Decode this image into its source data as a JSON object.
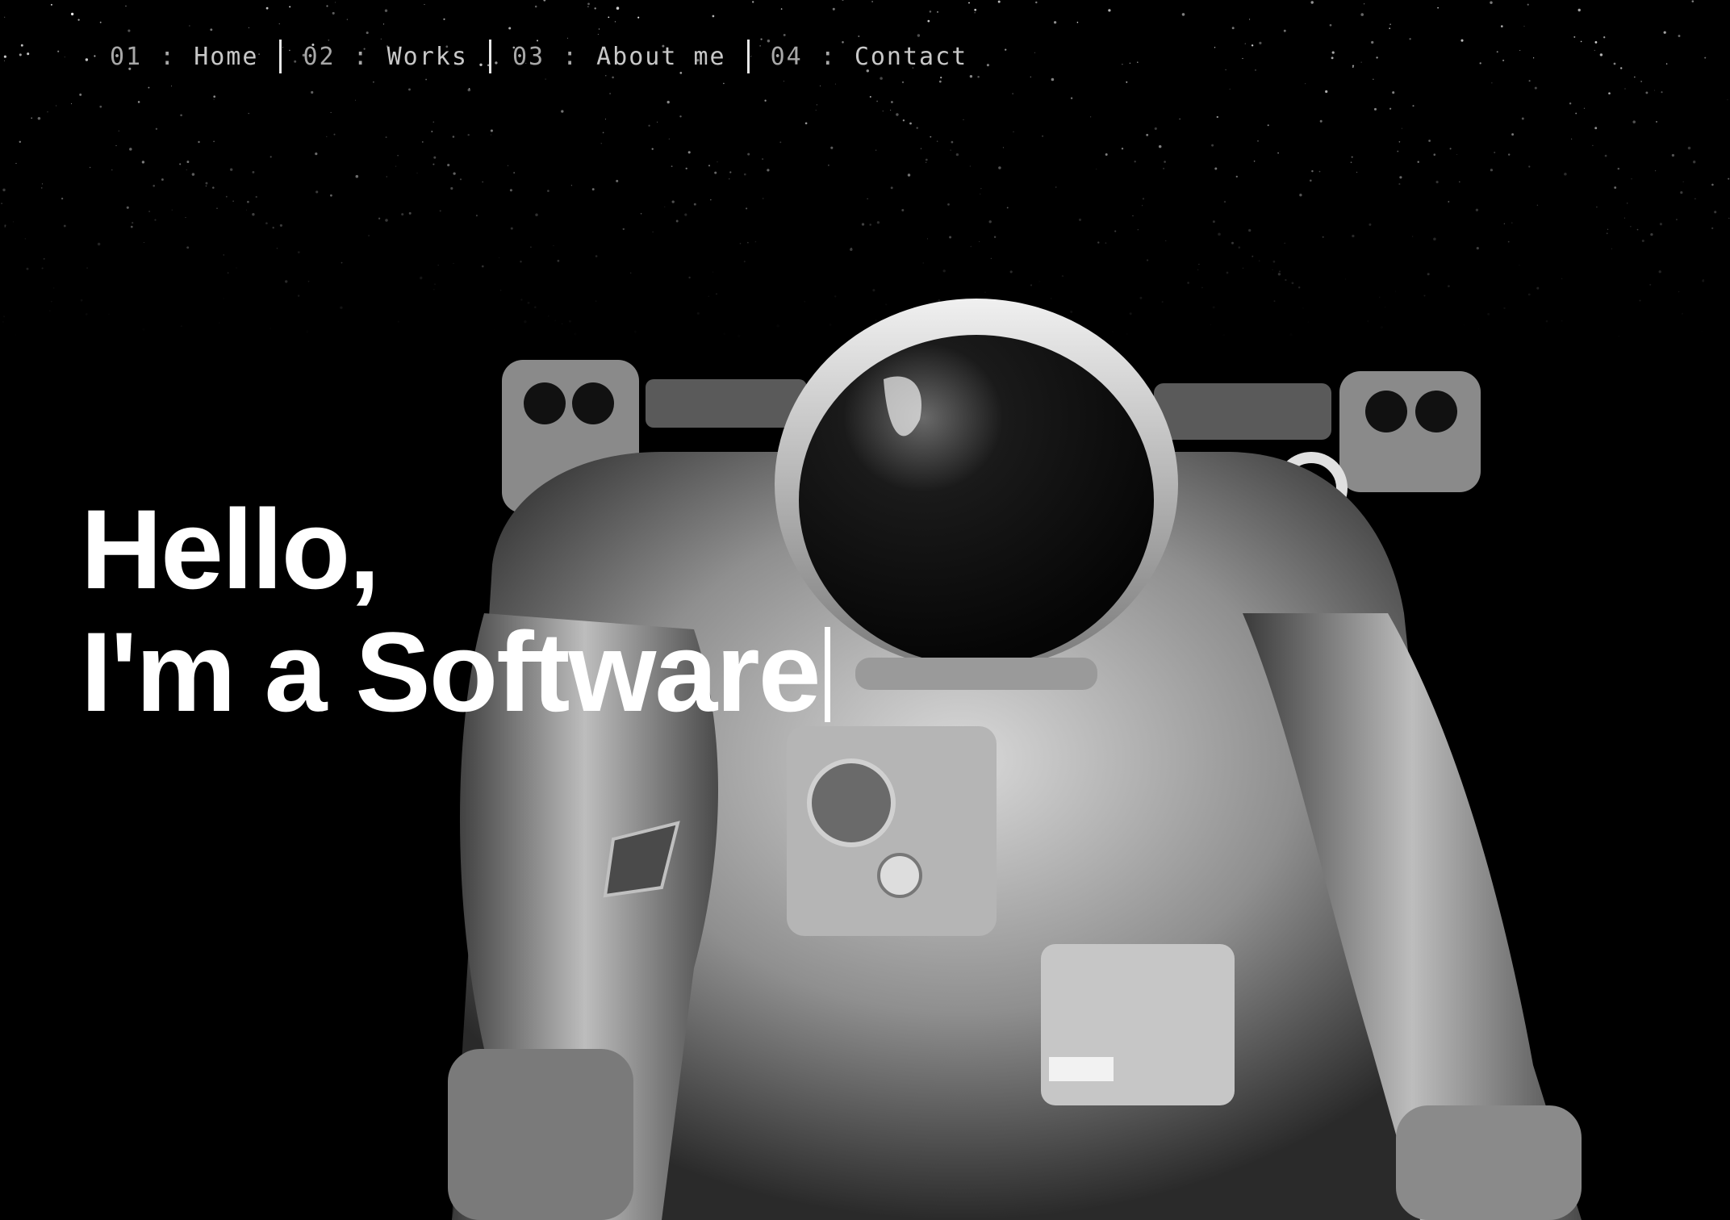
{
  "nav": {
    "items": [
      {
        "number": "01",
        "separator": ":",
        "label": "Home"
      },
      {
        "number": "02",
        "separator": ":",
        "label": "Works"
      },
      {
        "number": "03",
        "separator": ":",
        "label": "About me"
      },
      {
        "number": "04",
        "separator": ":",
        "label": "Contact"
      }
    ]
  },
  "hero": {
    "greeting": "Hello,",
    "typed_line": "I'm a Software"
  },
  "colors": {
    "background": "#000000",
    "headline": "#ffffff",
    "nav_text": "#c8c8c8"
  },
  "icons": {
    "caret": "text-caret-icon",
    "background": "astronaut-image"
  }
}
